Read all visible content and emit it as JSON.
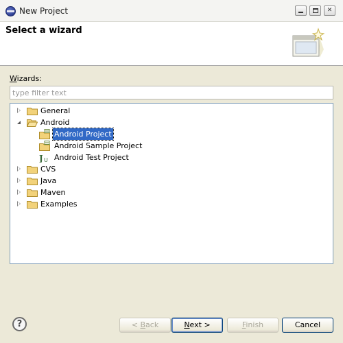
{
  "window": {
    "title": "New Project"
  },
  "banner": {
    "title": "Select a wizard"
  },
  "wizards": {
    "label_prefix": "W",
    "label_rest": "izards:",
    "filter_placeholder": "type filter text",
    "filter_value": ""
  },
  "tree": {
    "items": [
      {
        "label": "General",
        "state": "collapsed",
        "icon": "folder-icon"
      },
      {
        "label": "Android",
        "state": "expanded",
        "icon": "folder-open-icon"
      },
      {
        "label": "Android Project",
        "state": "leaf",
        "icon": "android-project-icon",
        "selected": true
      },
      {
        "label": "Android Sample Project",
        "state": "leaf",
        "icon": "android-project-icon"
      },
      {
        "label": "Android Test Project",
        "state": "leaf",
        "icon": "junit-icon"
      },
      {
        "label": "CVS",
        "state": "collapsed",
        "icon": "folder-icon"
      },
      {
        "label": "Java",
        "state": "collapsed",
        "icon": "folder-icon"
      },
      {
        "label": "Maven",
        "state": "collapsed",
        "icon": "folder-icon"
      },
      {
        "label": "Examples",
        "state": "collapsed",
        "icon": "folder-icon"
      }
    ]
  },
  "buttons": {
    "help_glyph": "?",
    "back_prefix": "< ",
    "back_mnemonic": "B",
    "back_rest": "ack",
    "next_mnemonic": "N",
    "next_rest": "ext >",
    "finish_mnemonic": "F",
    "finish_rest": "inish",
    "cancel_label": "Cancel"
  },
  "colors": {
    "selection": "#3169c6",
    "dialog_bg": "#ece9d8",
    "folder": "#f2d27a"
  }
}
